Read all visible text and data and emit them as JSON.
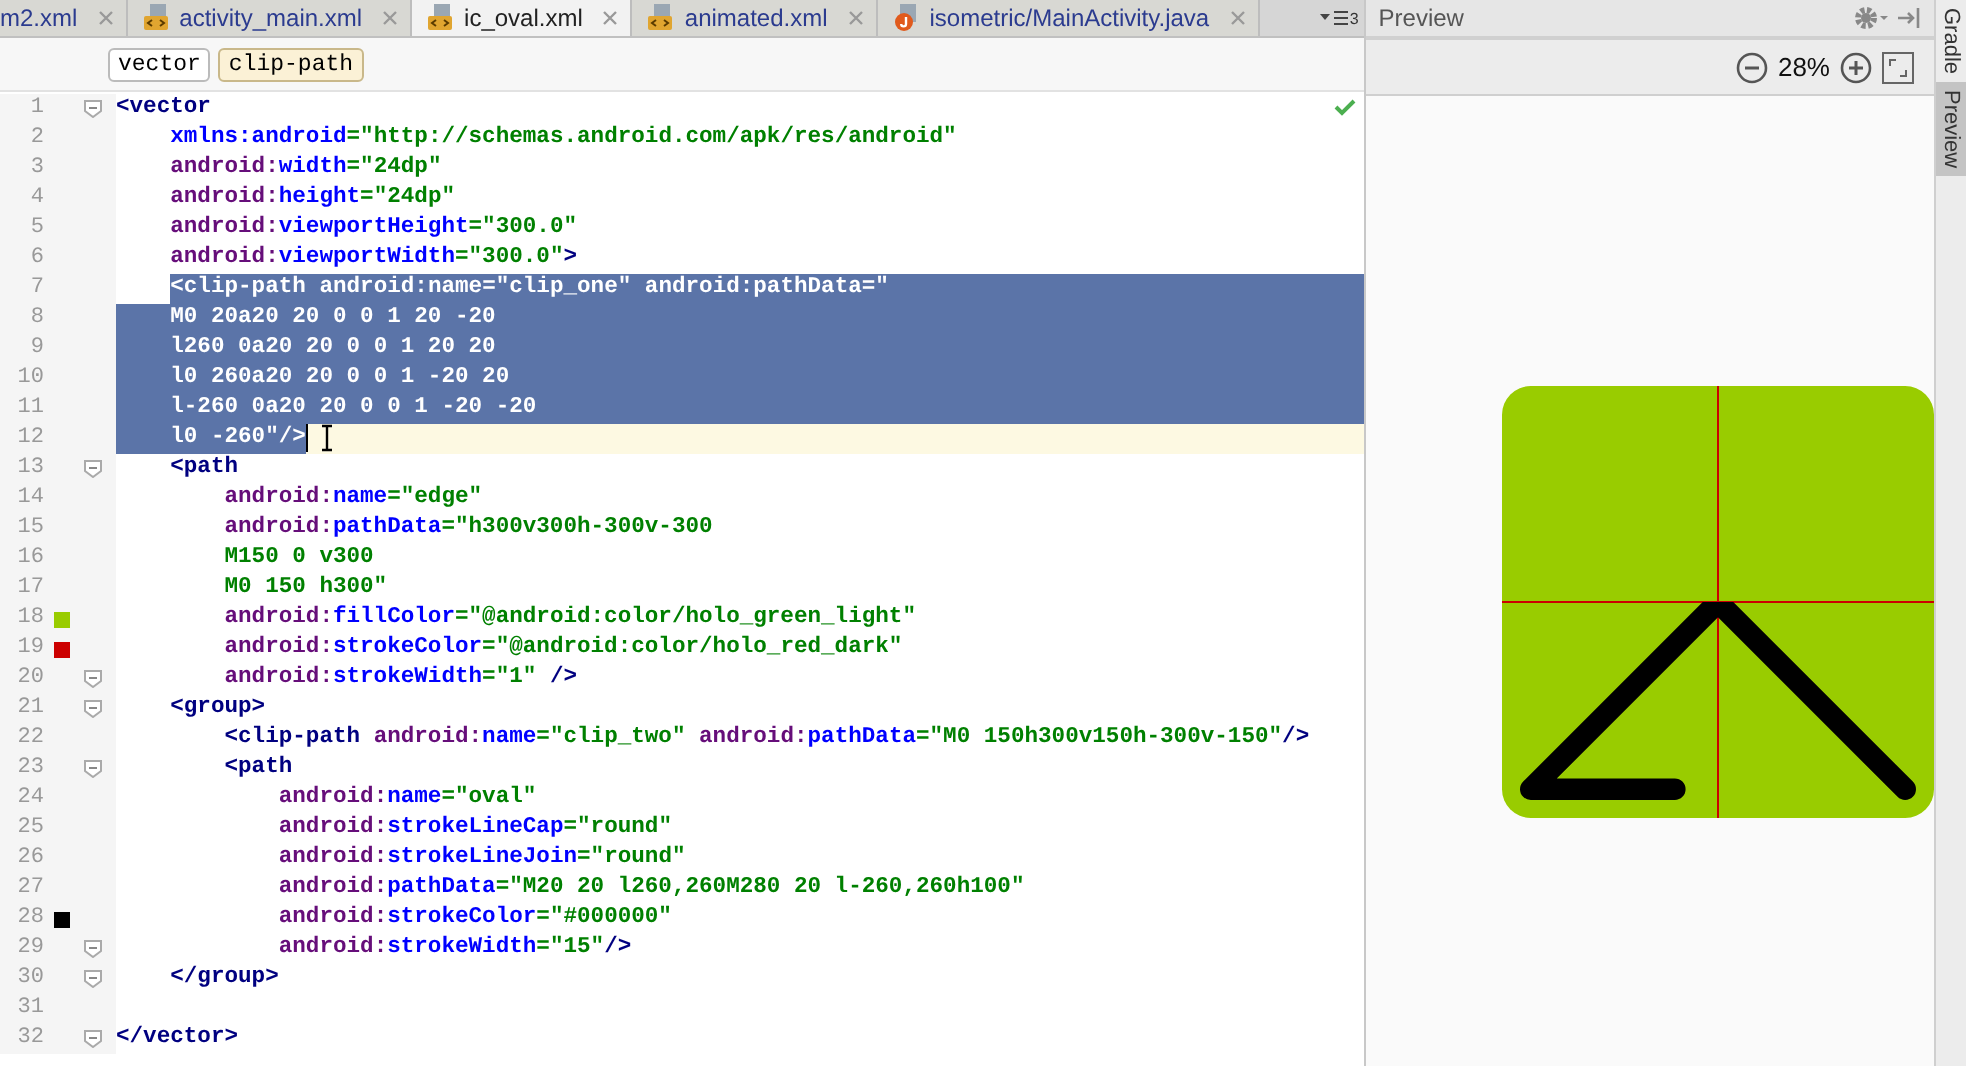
{
  "editor_tabs": [
    {
      "label": "m2.xml",
      "selected": false
    },
    {
      "label": "activity_main.xml",
      "kind": "xml",
      "selected": false
    },
    {
      "label": "ic_oval.xml",
      "kind": "xml",
      "selected": true
    },
    {
      "label": "animated.xml",
      "kind": "xml",
      "selected": false
    },
    {
      "label": "isometric/MainActivity.java",
      "kind": "java",
      "selected": false
    }
  ],
  "hidden_tab_count": "3",
  "breadcrumbs": [
    {
      "label": "vector",
      "selected": false
    },
    {
      "label": "clip-path",
      "selected": true
    }
  ],
  "code_lines": [
    {
      "number": "1",
      "fold": true,
      "selected": false,
      "current": false,
      "tokens": [
        {
          "kind": "tag",
          "text": "<vector"
        }
      ]
    },
    {
      "number": "2",
      "fold": false,
      "selected": false,
      "current": false,
      "tokens": [
        {
          "kind": "attr",
          "text": "    xmlns:android"
        },
        {
          "kind": "value",
          "text": "=\"http://schemas.android.com/apk/res/android\""
        }
      ]
    },
    {
      "number": "3",
      "fold": false,
      "selected": false,
      "current": false,
      "tokens": [
        {
          "kind": "prefix",
          "text": "    android:"
        },
        {
          "kind": "attr",
          "text": "width"
        },
        {
          "kind": "value",
          "text": "=\"24dp\""
        }
      ]
    },
    {
      "number": "4",
      "fold": false,
      "selected": false,
      "current": false,
      "tokens": [
        {
          "kind": "prefix",
          "text": "    android:"
        },
        {
          "kind": "attr",
          "text": "height"
        },
        {
          "kind": "value",
          "text": "=\"24dp\""
        }
      ]
    },
    {
      "number": "5",
      "fold": false,
      "selected": false,
      "current": false,
      "tokens": [
        {
          "kind": "prefix",
          "text": "    android:"
        },
        {
          "kind": "attr",
          "text": "viewportHeight"
        },
        {
          "kind": "value",
          "text": "=\"300.0\""
        }
      ]
    },
    {
      "number": "6",
      "fold": false,
      "selected": false,
      "current": false,
      "tokens": [
        {
          "kind": "prefix",
          "text": "    android:"
        },
        {
          "kind": "attr",
          "text": "viewportWidth"
        },
        {
          "kind": "value",
          "text": "=\"300.0\""
        },
        {
          "kind": "tag",
          "text": ">"
        }
      ]
    },
    {
      "number": "7",
      "fold": false,
      "selected": true,
      "current": false,
      "tokens": [
        {
          "kind": "tag",
          "text": "    <clip-path "
        },
        {
          "kind": "prefix",
          "text": "android:"
        },
        {
          "kind": "attr",
          "text": "name"
        },
        {
          "kind": "value",
          "text": "=\"clip_one\" "
        },
        {
          "kind": "prefix",
          "text": "android:"
        },
        {
          "kind": "attr",
          "text": "pathData"
        },
        {
          "kind": "value",
          "text": "=\""
        }
      ]
    },
    {
      "number": "8",
      "fold": false,
      "selected": true,
      "current": false,
      "tokens": [
        {
          "kind": "value",
          "text": "    M0 20a20 20 0 0 1 20 -20"
        }
      ]
    },
    {
      "number": "9",
      "fold": false,
      "selected": true,
      "current": false,
      "tokens": [
        {
          "kind": "value",
          "text": "    l260 0a20 20 0 0 1 20 20"
        }
      ]
    },
    {
      "number": "10",
      "fold": false,
      "selected": true,
      "current": false,
      "tokens": [
        {
          "kind": "value",
          "text": "    l0 260a20 20 0 0 1 -20 20"
        }
      ]
    },
    {
      "number": "11",
      "fold": false,
      "selected": true,
      "current": false,
      "tokens": [
        {
          "kind": "value",
          "text": "    l-260 0a20 20 0 0 1 -20 -20"
        }
      ]
    },
    {
      "number": "12",
      "fold": false,
      "selected": true,
      "current": true,
      "tokens": [
        {
          "kind": "value",
          "text": "    l0 -260\""
        },
        {
          "kind": "tag",
          "text": "/>"
        }
      ]
    },
    {
      "number": "13",
      "fold": true,
      "selected": false,
      "current": false,
      "tokens": [
        {
          "kind": "tag",
          "text": "    <path"
        }
      ]
    },
    {
      "number": "14",
      "fold": false,
      "selected": false,
      "current": false,
      "tokens": [
        {
          "kind": "prefix",
          "text": "        android:"
        },
        {
          "kind": "attr",
          "text": "name"
        },
        {
          "kind": "value",
          "text": "=\"edge\""
        }
      ]
    },
    {
      "number": "15",
      "fold": false,
      "selected": false,
      "current": false,
      "tokens": [
        {
          "kind": "prefix",
          "text": "        android:"
        },
        {
          "kind": "attr",
          "text": "pathData"
        },
        {
          "kind": "value",
          "text": "=\"h300v300h-300v-300"
        }
      ]
    },
    {
      "number": "16",
      "fold": false,
      "selected": false,
      "current": false,
      "tokens": [
        {
          "kind": "value",
          "text": "        M150 0 v300"
        }
      ]
    },
    {
      "number": "17",
      "fold": false,
      "selected": false,
      "current": false,
      "tokens": [
        {
          "kind": "value",
          "text": "        M0 150 h300\""
        }
      ]
    },
    {
      "number": "18",
      "fold": false,
      "selected": false,
      "current": false,
      "color": "#99cc00",
      "tokens": [
        {
          "kind": "prefix",
          "text": "        android:"
        },
        {
          "kind": "attr",
          "text": "fillColor"
        },
        {
          "kind": "value",
          "text": "=\"@android:color/holo_green_light\""
        }
      ]
    },
    {
      "number": "19",
      "fold": false,
      "selected": false,
      "current": false,
      "color": "#cc0000",
      "tokens": [
        {
          "kind": "prefix",
          "text": "        android:"
        },
        {
          "kind": "attr",
          "text": "strokeColor"
        },
        {
          "kind": "value",
          "text": "=\"@android:color/holo_red_dark\""
        }
      ]
    },
    {
      "number": "20",
      "fold": true,
      "selected": false,
      "current": false,
      "tokens": [
        {
          "kind": "prefix",
          "text": "        android:"
        },
        {
          "kind": "attr",
          "text": "strokeWidth"
        },
        {
          "kind": "value",
          "text": "=\"1\""
        },
        {
          "kind": "tag",
          "text": " />"
        }
      ]
    },
    {
      "number": "21",
      "fold": true,
      "selected": false,
      "current": false,
      "tokens": [
        {
          "kind": "tag",
          "text": "    <group>"
        }
      ]
    },
    {
      "number": "22",
      "fold": false,
      "selected": false,
      "current": false,
      "tokens": [
        {
          "kind": "tag",
          "text": "        <clip-path "
        },
        {
          "kind": "prefix",
          "text": "android:"
        },
        {
          "kind": "attr",
          "text": "name"
        },
        {
          "kind": "value",
          "text": "=\"clip_two\" "
        },
        {
          "kind": "prefix",
          "text": "android:"
        },
        {
          "kind": "attr",
          "text": "pathData"
        },
        {
          "kind": "value",
          "text": "=\"M0 150h300v150h-300v-150\""
        },
        {
          "kind": "tag",
          "text": "/>"
        }
      ]
    },
    {
      "number": "23",
      "fold": true,
      "selected": false,
      "current": false,
      "tokens": [
        {
          "kind": "tag",
          "text": "        <path"
        }
      ]
    },
    {
      "number": "24",
      "fold": false,
      "selected": false,
      "current": false,
      "tokens": [
        {
          "kind": "prefix",
          "text": "            android:"
        },
        {
          "kind": "attr",
          "text": "name"
        },
        {
          "kind": "value",
          "text": "=\"oval\""
        }
      ]
    },
    {
      "number": "25",
      "fold": false,
      "selected": false,
      "current": false,
      "tokens": [
        {
          "kind": "prefix",
          "text": "            android:"
        },
        {
          "kind": "attr",
          "text": "strokeLineCap"
        },
        {
          "kind": "value",
          "text": "=\"round\""
        }
      ]
    },
    {
      "number": "26",
      "fold": false,
      "selected": false,
      "current": false,
      "tokens": [
        {
          "kind": "prefix",
          "text": "            android:"
        },
        {
          "kind": "attr",
          "text": "strokeLineJoin"
        },
        {
          "kind": "value",
          "text": "=\"round\""
        }
      ]
    },
    {
      "number": "27",
      "fold": false,
      "selected": false,
      "current": false,
      "tokens": [
        {
          "kind": "prefix",
          "text": "            android:"
        },
        {
          "kind": "attr",
          "text": "pathData"
        },
        {
          "kind": "value",
          "text": "=\"M20 20 l260,260M280 20 l-260,260h100\""
        }
      ]
    },
    {
      "number": "28",
      "fold": false,
      "selected": false,
      "current": false,
      "color": "#000000",
      "tokens": [
        {
          "kind": "prefix",
          "text": "            android:"
        },
        {
          "kind": "attr",
          "text": "strokeColor"
        },
        {
          "kind": "value",
          "text": "=\"#000000\""
        }
      ]
    },
    {
      "number": "29",
      "fold": true,
      "selected": false,
      "current": false,
      "tokens": [
        {
          "kind": "prefix",
          "text": "            android:"
        },
        {
          "kind": "attr",
          "text": "strokeWidth"
        },
        {
          "kind": "value",
          "text": "=\"15\""
        },
        {
          "kind": "tag",
          "text": "/>"
        }
      ]
    },
    {
      "number": "30",
      "fold": true,
      "selected": false,
      "current": false,
      "tokens": [
        {
          "kind": "tag",
          "text": "    </group>"
        }
      ]
    },
    {
      "number": "31",
      "fold": false,
      "selected": false,
      "current": false
    },
    {
      "number": "32",
      "fold": true,
      "selected": false,
      "current": false,
      "tokens": [
        {
          "kind": "tag",
          "text": "</vector>"
        }
      ]
    }
  ],
  "preview": {
    "title": "Preview",
    "zoom": "28%"
  },
  "side_tabs": [
    {
      "label": "Gradle",
      "selected": false
    },
    {
      "label": "Preview",
      "selected": true
    }
  ]
}
